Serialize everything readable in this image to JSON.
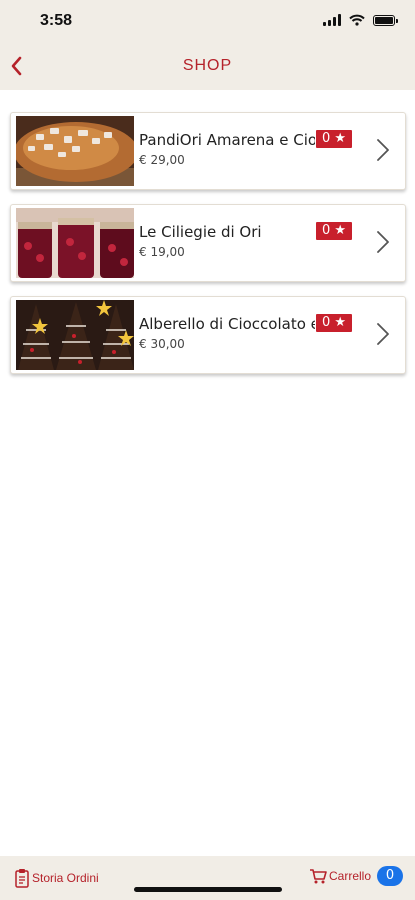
{
  "status_bar": {
    "time": "3:58"
  },
  "header": {
    "title": "SHOP"
  },
  "products": [
    {
      "name": "PandiOri Amarena e Cioccolato",
      "price": "€ 29,00",
      "rating": "0 ★"
    },
    {
      "name": "Le Ciliegie di Ori",
      "price": "€ 19,00",
      "rating": "0 ★"
    },
    {
      "name": "Alberello di Cioccolato e",
      "price": "€ 30,00",
      "rating": "0 ★"
    }
  ],
  "bottom_bar": {
    "orders_label": "Storia Ordini",
    "cart_label": "Carrello",
    "cart_count": "0"
  },
  "colors": {
    "accent": "#b5222a",
    "badge": "#c8202c",
    "bar_bg": "#f1ede6",
    "cart_badge": "#1a73e8"
  }
}
